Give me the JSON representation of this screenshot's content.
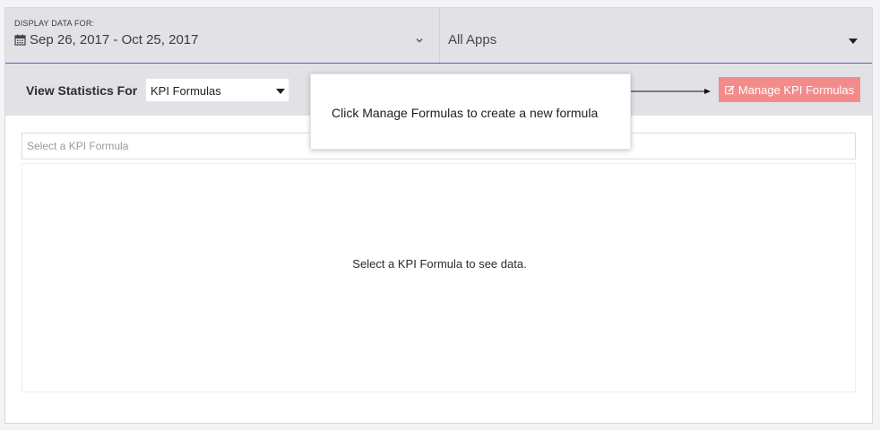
{
  "filters": {
    "date_caption": "DISPLAY DATA FOR:",
    "date_range": "Sep 26, 2017 - Oct 25, 2017",
    "apps_value": "All Apps"
  },
  "stats": {
    "label": "View Statistics For",
    "selected": "KPI Formulas",
    "manage_button": "Manage KPI Formulas"
  },
  "tooltip": {
    "text": "Click Manage Formulas to create a new formula"
  },
  "content": {
    "kpi_placeholder": "Select a KPI Formula",
    "empty_message": "Select a KPI Formula to see data."
  },
  "colors": {
    "accent_underline": "#5b66b5",
    "manage_button_bg": "#f48b8b",
    "bar_bg": "#e1e1e6"
  }
}
